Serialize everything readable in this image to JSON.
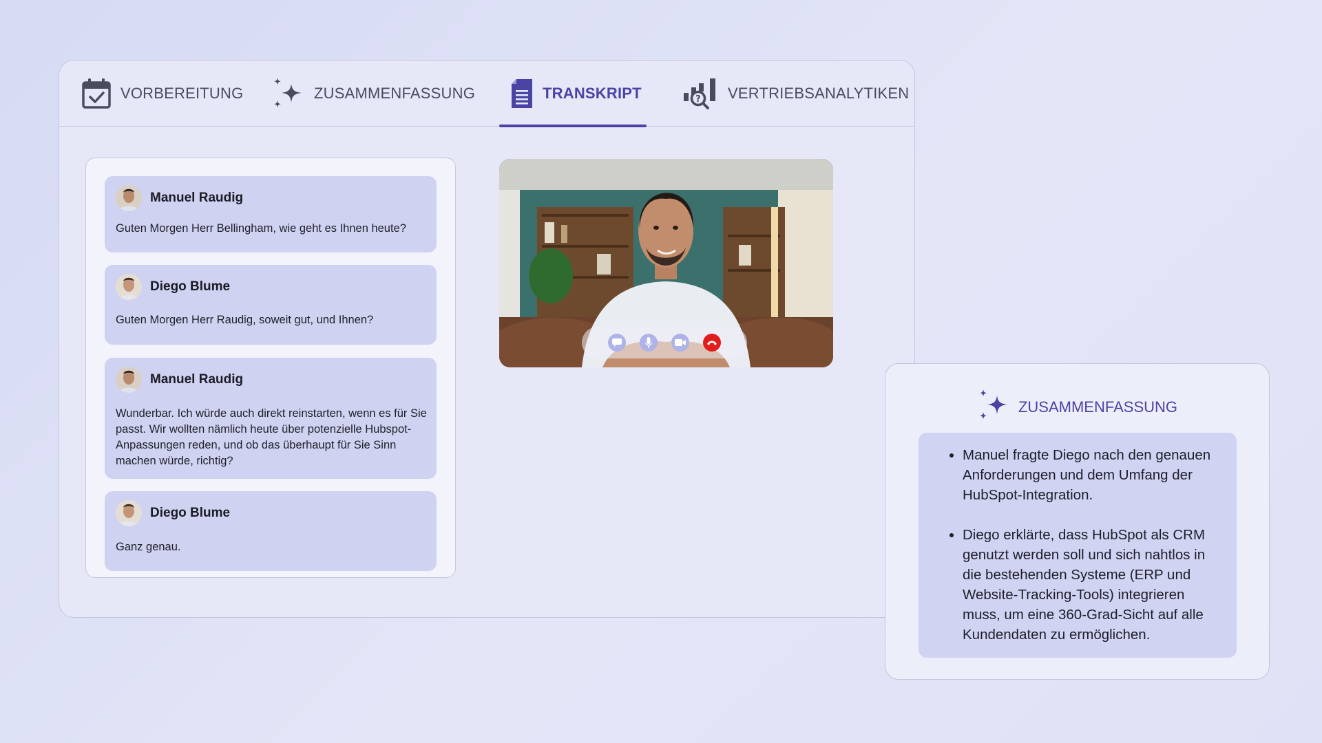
{
  "tabs": [
    {
      "id": "vorbereitung",
      "label": "VORBEREITUNG",
      "icon": "calendar-check-icon",
      "active": false
    },
    {
      "id": "zusammenfassung",
      "label": "ZUSAMMENFASSUNG",
      "icon": "sparkles-icon",
      "active": false
    },
    {
      "id": "transkript",
      "label": "TRANSKRIPT",
      "icon": "document-icon",
      "active": true
    },
    {
      "id": "vertriebsanalytiken",
      "label": "VERTRIEBSANALYTIKEN",
      "icon": "analytics-search-icon",
      "active": false
    }
  ],
  "transcript": {
    "messages": [
      {
        "sender": "Manuel Raudig",
        "text": "Guten Morgen Herr Bellingham, wie geht es Ihnen heute?"
      },
      {
        "sender": "Diego Blume",
        "text": "Guten Morgen Herr Raudig, soweit gut, und Ihnen?"
      },
      {
        "sender": "Manuel Raudig",
        "text": "Wunderbar. Ich würde auch direkt reinstarten, wenn es für Sie passt. Wir wollten nämlich heute über potenzielle Hubspot-Anpassungen reden, und ob das überhaupt für Sie Sinn machen würde, richtig?"
      },
      {
        "sender": "Diego Blume",
        "text": "Ganz genau."
      }
    ]
  },
  "video": {
    "controls": [
      "chat-icon",
      "microphone-icon",
      "camera-icon",
      "end-call-icon"
    ]
  },
  "summary": {
    "title": "ZUSAMMENFASSUNG",
    "bullets": [
      "Manuel fragte Diego nach den genauen Anforderungen und dem Umfang der HubSpot-Integration.",
      "Diego erklärte, dass HubSpot als CRM genutzt werden soll und sich nahtlos in die bestehenden Systeme (ERP und Website-Tracking-Tools) integrieren muss, um eine 360-Grad-Sicht auf alle Kundendaten zu ermöglichen."
    ]
  },
  "colors": {
    "accent": "#4b43a4",
    "bubble": "#cfd2f0",
    "end_call": "#e21d1d"
  }
}
